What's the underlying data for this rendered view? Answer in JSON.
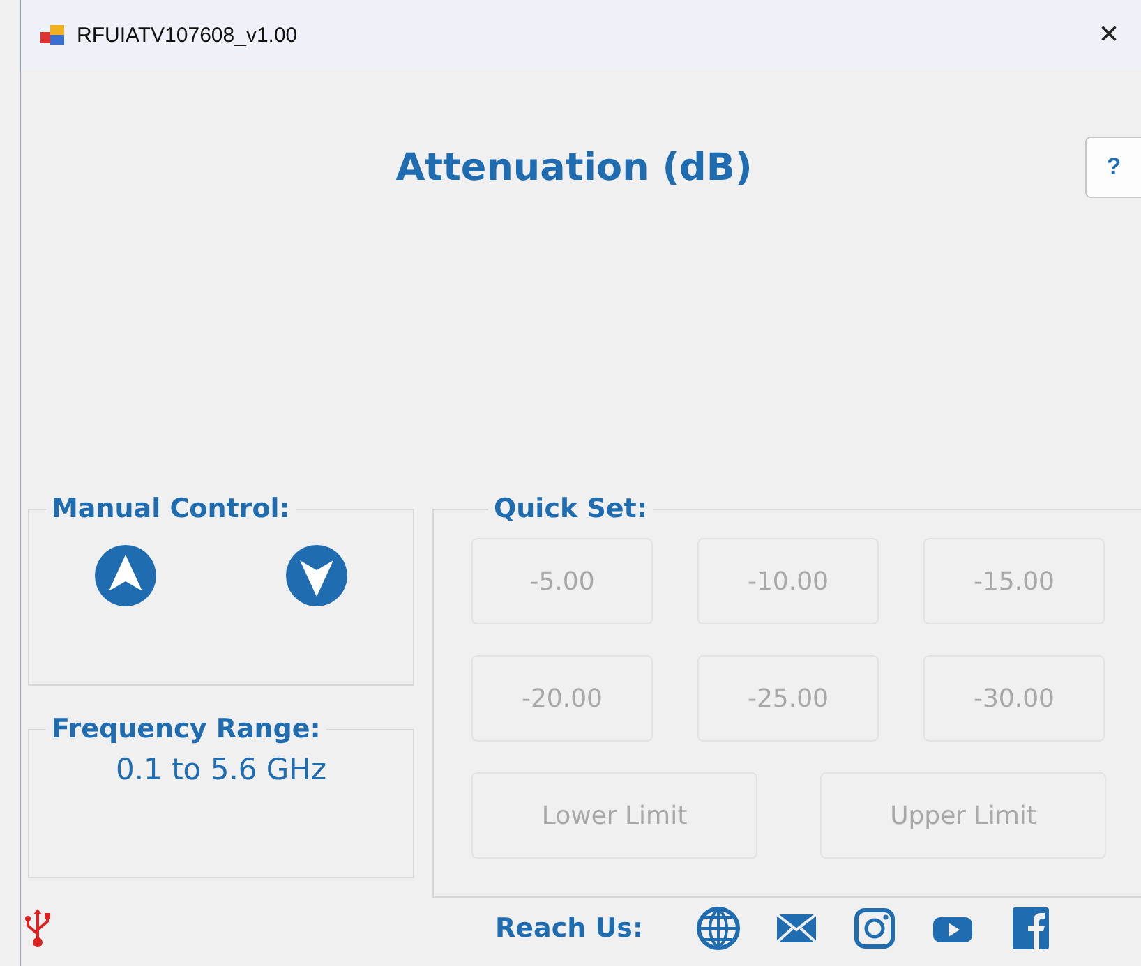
{
  "window": {
    "title": "RFUIATV107608_v1.00",
    "close": "×"
  },
  "heading": "Attenuation (dB)",
  "help_button": "?",
  "manual_control": {
    "title": "Manual Control:",
    "buttons": [
      {
        "kind": "up"
      },
      {
        "kind": "down"
      }
    ]
  },
  "frequency_range": {
    "title": "Frequency Range:",
    "value": "0.1 to 5.6 GHz"
  },
  "quick_set": {
    "title": "Quick Set:",
    "buttons": [
      {
        "label": "-5.00",
        "disabled": true
      },
      {
        "label": "-10.00",
        "disabled": true
      },
      {
        "label": "-15.00",
        "disabled": true
      },
      {
        "label": "-20.00",
        "disabled": true
      },
      {
        "label": "-25.00",
        "disabled": true
      },
      {
        "label": "-30.00",
        "disabled": true
      }
    ],
    "limit_buttons": [
      {
        "label": "Lower Limit",
        "disabled": true
      },
      {
        "label": "Upper Limit",
        "disabled": true
      }
    ]
  },
  "footer": {
    "label": "Reach Us:",
    "links": [
      {
        "kind": "web"
      },
      {
        "kind": "mail"
      },
      {
        "kind": "instagram"
      },
      {
        "kind": "video"
      },
      {
        "kind": "facebook"
      }
    ]
  }
}
